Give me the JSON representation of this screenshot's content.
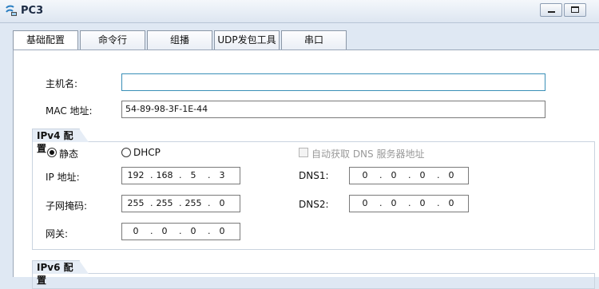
{
  "window": {
    "title": "PC3",
    "icon": "pc-app-icon"
  },
  "tabs": [
    {
      "label": "基础配置",
      "active": true
    },
    {
      "label": "命令行",
      "active": false
    },
    {
      "label": "组播",
      "active": false
    },
    {
      "label": "UDP发包工具",
      "active": false
    },
    {
      "label": "串口",
      "active": false
    }
  ],
  "basic": {
    "hostname_label": "主机名:",
    "hostname_value": "",
    "mac_label": "MAC 地址:",
    "mac_value": "54-89-98-3F-1E-44"
  },
  "ipv4": {
    "group_title": "IPv4 配置",
    "static_label": "静态",
    "static_selected": true,
    "dhcp_label": "DHCP",
    "auto_dns_label": "自动获取 DNS 服务器地址",
    "ip_label": "IP 地址:",
    "ip": [
      "192",
      "168",
      "5",
      "3"
    ],
    "mask_label": "子网掩码:",
    "mask": [
      "255",
      "255",
      "255",
      "0"
    ],
    "gateway_label": "网关:",
    "gateway": [
      "0",
      "0",
      "0",
      "0"
    ],
    "dns1_label": "DNS1:",
    "dns1": [
      "0",
      "0",
      "0",
      "0"
    ],
    "dns2_label": "DNS2:",
    "dns2": [
      "0",
      "0",
      "0",
      "0"
    ]
  },
  "ipv6": {
    "group_title": "IPv6 配置"
  }
}
